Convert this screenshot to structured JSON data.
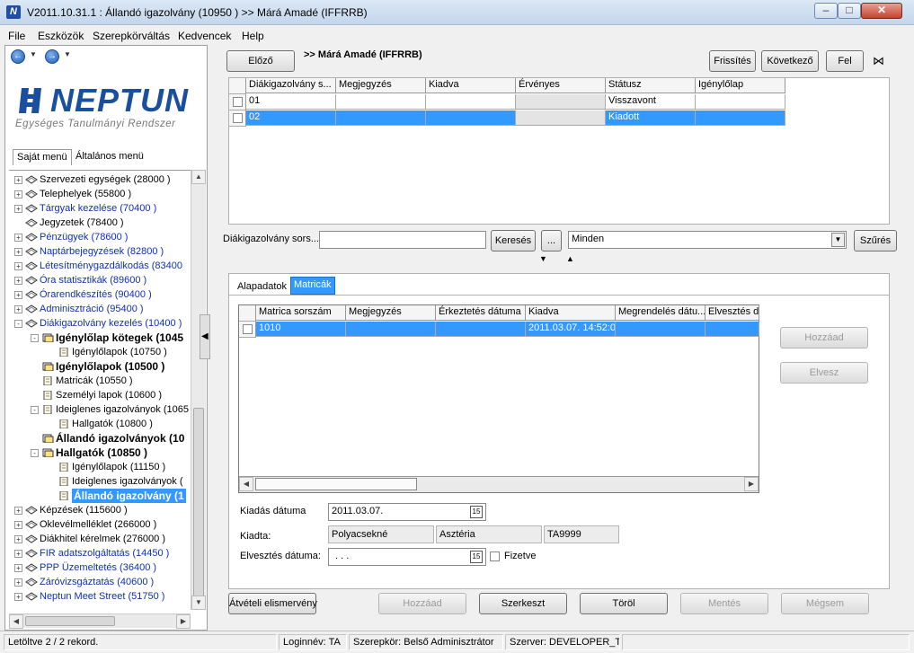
{
  "window": {
    "title": "V2011.10.31.1 : Állandó igazolvány (10950  ) >> Márá Amadé (IFFRRB)",
    "app_icon_letter": "N"
  },
  "menu": [
    "File",
    "Eszközök",
    "Szerepkörváltás",
    "Kedvencek",
    "Help"
  ],
  "logo": {
    "word": "NEPTUN",
    "subtitle": "Egységes Tanulmányi Rendszer"
  },
  "left_tabs": {
    "own": "Saját menü",
    "general": "Általános menü"
  },
  "tree": [
    {
      "label": "Szervezeti egységek (28000 )",
      "level": 0,
      "exp": "+",
      "blue": false,
      "type": "folder"
    },
    {
      "label": "Telephelyek (55800 )",
      "level": 0,
      "exp": "+",
      "blue": false,
      "type": "folder"
    },
    {
      "label": "Tárgyak kezelése (70400 )",
      "level": 0,
      "exp": "+",
      "blue": true,
      "type": "folder"
    },
    {
      "label": "Jegyzetek (78400 )",
      "level": 0,
      "exp": "",
      "blue": false,
      "type": "folder"
    },
    {
      "label": "Pénzügyek (78600 )",
      "level": 0,
      "exp": "+",
      "blue": true,
      "type": "folder"
    },
    {
      "label": "Naptárbejegyzések (82800 )",
      "level": 0,
      "exp": "+",
      "blue": true,
      "type": "folder"
    },
    {
      "label": "Létesítménygazdálkodás (83400",
      "level": 0,
      "exp": "+",
      "blue": true,
      "type": "folder"
    },
    {
      "label": "Óra statisztikák (89600 )",
      "level": 0,
      "exp": "+",
      "blue": true,
      "type": "folder"
    },
    {
      "label": "Órarendkészítés (90400 )",
      "level": 0,
      "exp": "+",
      "blue": true,
      "type": "folder"
    },
    {
      "label": "Adminisztráció (95400 )",
      "level": 0,
      "exp": "+",
      "blue": true,
      "type": "folder"
    },
    {
      "label": "Diákigazolvány kezelés (10400 )",
      "level": 0,
      "exp": "-",
      "blue": true,
      "type": "folder"
    },
    {
      "label": "Igénylőlap kötegek (1045",
      "level": 1,
      "exp": "-",
      "blue": false,
      "type": "dfolder",
      "bold": true
    },
    {
      "label": "Igénylőlapok (10750 )",
      "level": 2,
      "exp": "",
      "blue": false,
      "type": "page"
    },
    {
      "label": "Igénylőlapok (10500 )",
      "level": 1,
      "exp": "",
      "blue": false,
      "type": "dfolder",
      "bold": true
    },
    {
      "label": "Matricák (10550 )",
      "level": 1,
      "exp": "",
      "blue": false,
      "type": "page"
    },
    {
      "label": "Személyi lapok (10600 )",
      "level": 1,
      "exp": "",
      "blue": false,
      "type": "page"
    },
    {
      "label": "Ideiglenes igazolványok (1065",
      "level": 1,
      "exp": "-",
      "blue": false,
      "type": "page"
    },
    {
      "label": "Hallgatók (10800 )",
      "level": 2,
      "exp": "",
      "blue": false,
      "type": "page"
    },
    {
      "label": "Állandó igazolványok (10",
      "level": 1,
      "exp": "",
      "blue": false,
      "type": "dfolder",
      "bold": true
    },
    {
      "label": "Hallgatók (10850 )",
      "level": 1,
      "exp": "-",
      "blue": false,
      "type": "dfolder",
      "bold": true
    },
    {
      "label": "Igénylőlapok (11150 )",
      "level": 2,
      "exp": "",
      "blue": false,
      "type": "page"
    },
    {
      "label": "Ideiglenes igazolványok (",
      "level": 2,
      "exp": "",
      "blue": false,
      "type": "page"
    },
    {
      "label": "Állandó igazolvány (1",
      "level": 2,
      "exp": "",
      "blue": false,
      "type": "page",
      "bold": true,
      "selected": true
    },
    {
      "label": "Képzések (115600 )",
      "level": 0,
      "exp": "+",
      "blue": false,
      "type": "folder"
    },
    {
      "label": "Oklevélmelléklet (266000 )",
      "level": 0,
      "exp": "+",
      "blue": false,
      "type": "folder"
    },
    {
      "label": "Diákhitel kérelmek (276000 )",
      "level": 0,
      "exp": "+",
      "blue": false,
      "type": "folder"
    },
    {
      "label": "FIR adatszolgáltatás (14450 )",
      "level": 0,
      "exp": "+",
      "blue": true,
      "type": "folder"
    },
    {
      "label": "PPP Üzemeltetés (36400 )",
      "level": 0,
      "exp": "+",
      "blue": true,
      "type": "folder"
    },
    {
      "label": "Záróvizsgáztatás (40600 )",
      "level": 0,
      "exp": "+",
      "blue": true,
      "type": "folder"
    },
    {
      "label": "Neptun Meet Street (51750 )",
      "level": 0,
      "exp": "+",
      "blue": true,
      "type": "folder"
    }
  ],
  "top": {
    "prev": "Előző",
    "student": ">> Márá Amadé (IFFRRB)",
    "refresh": "Frissítés",
    "next": "Következő",
    "up": "Fel"
  },
  "grid1": {
    "columns": [
      "Diákigazolvány s...",
      "Megjegyzés",
      "Kiadva",
      "Érvényes",
      "Státusz",
      "Igénylőlap"
    ],
    "rows": [
      [
        "01",
        "",
        "",
        "",
        "Visszavont",
        ""
      ],
      [
        "02",
        "",
        "",
        "",
        "Kiadott",
        ""
      ]
    ]
  },
  "filter": {
    "label": "Diákigazolvány sors...",
    "search_value": "",
    "search_btn": "Keresés",
    "dots_btn": "...",
    "combo_value": "Minden",
    "apply_btn": "Szűrés"
  },
  "tabs": [
    "Alapadatok",
    "Matricák"
  ],
  "grid2": {
    "columns": [
      "Matrica sorszám",
      "Megjegyzés",
      "Érkeztetés dátuma",
      "Kiadva",
      "Megrendelés dátu...",
      "Elvesztés d"
    ],
    "rows": [
      [
        "1010",
        "",
        "",
        "2011.03.07. 14:52:0",
        "",
        ""
      ]
    ]
  },
  "side_buttons": {
    "add": "Hozzáad",
    "remove": "Elvesz"
  },
  "form": {
    "issue_date_label": "Kiadás dátuma",
    "issue_date": "2011.03.07.",
    "issued_by_label": "Kiadta:",
    "issued_by": [
      "Polyacsekné",
      "Asztéria",
      "TA9999"
    ],
    "lost_date_label": "Elvesztés dátuma:",
    "lost_date": ". . .",
    "paid_label": "Fizetve",
    "calendar_glyph": "15"
  },
  "bottom_buttons": {
    "receipt": "Átvételi elismervény",
    "add": "Hozzáad",
    "edit": "Szerkeszt",
    "delete": "Töröl",
    "save": "Mentés",
    "cancel": "Mégsem"
  },
  "status": {
    "records": "Letöltve 2 / 2 rekord.",
    "login": "Loginnév: TA",
    "role": "Szerepkör: Belső Adminisztrátor",
    "server": "Szerver: DEVELOPER_Te"
  },
  "colors": {
    "selection": "#3399ff",
    "neptun_blue": "#1a4f9e",
    "link_blue": "#1030b0"
  }
}
